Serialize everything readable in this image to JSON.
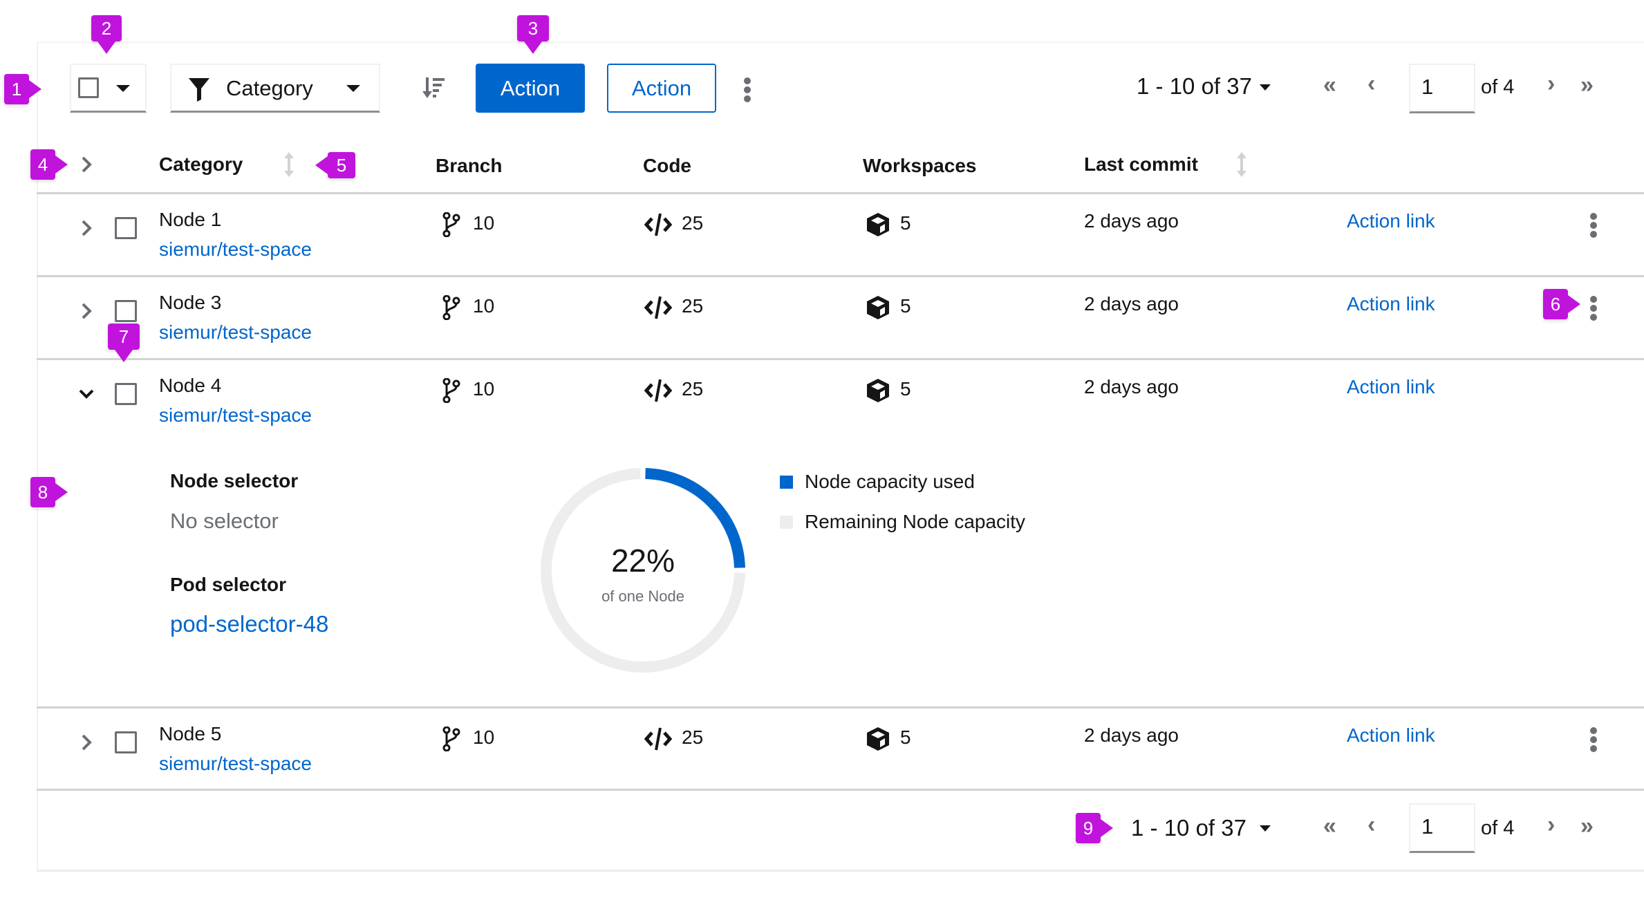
{
  "toolbar": {
    "bulk_select": {
      "checked": false,
      "icon": "caret-down-icon"
    },
    "filter": {
      "icon": "filter-icon",
      "label": "Category"
    },
    "sort_icon": "sort-amount-down-icon",
    "primary_action": "Action",
    "secondary_action": "Action",
    "overflow_icon": "kebab-icon"
  },
  "pagination_top": {
    "range_start": "1",
    "range_end": "10",
    "range_sep": " - ",
    "of_label": "of",
    "total": "37",
    "page": "1",
    "of_pages": "of 4",
    "icons": [
      "angle-double-left-icon",
      "angle-left-icon",
      "angle-right-icon",
      "angle-double-right-icon"
    ]
  },
  "pagination_bottom": {
    "range_start": "1",
    "range_end": "10",
    "range_sep": " - ",
    "of_label": "of",
    "total": "37",
    "page": "1",
    "of_pages": "of 4"
  },
  "table": {
    "columns": [
      "Category",
      "Branch",
      "Code",
      "Workspaces",
      "Last commit"
    ],
    "rows": [
      {
        "name": "Node 1",
        "link": "siemur/test-space",
        "branches": "10",
        "code": "25",
        "workspaces": "5",
        "last_commit": "2 days ago",
        "action": "Action link",
        "expanded": false,
        "kebab": true
      },
      {
        "name": "Node 3",
        "link": "siemur/test-space",
        "branches": "10",
        "code": "25",
        "workspaces": "5",
        "last_commit": "2 days ago",
        "action": "Action link",
        "expanded": false,
        "kebab": true
      },
      {
        "name": "Node 4",
        "link": "siemur/test-space",
        "branches": "10",
        "code": "25",
        "workspaces": "5",
        "last_commit": "2 days ago",
        "action": "Action link",
        "expanded": true,
        "kebab": false
      },
      {
        "name": "Node 5",
        "link": "siemur/test-space",
        "branches": "10",
        "code": "25",
        "workspaces": "5",
        "last_commit": "2 days ago",
        "action": "Action link",
        "expanded": false,
        "kebab": true
      }
    ]
  },
  "expanded": {
    "node_selector_label": "Node selector",
    "node_selector_value": "No selector",
    "pod_selector_label": "Pod selector",
    "pod_selector_value": "pod-selector-48",
    "donut": {
      "value_label": "22%",
      "subtitle": "of one Node",
      "used_percent": 22,
      "used_color": "#0066cc",
      "remaining_color": "#ededed"
    },
    "legend": [
      {
        "label": "Node capacity used",
        "color": "#0066cc"
      },
      {
        "label": "Remaining Node capacity",
        "color": "#ededed"
      }
    ]
  },
  "callouts": [
    "1",
    "2",
    "3",
    "4",
    "5",
    "6",
    "7",
    "8",
    "9"
  ],
  "colors": {
    "accent": "#0066cc",
    "callout": "#c014dd",
    "border": "#d2d2d2",
    "icon": "#6a6e73"
  }
}
